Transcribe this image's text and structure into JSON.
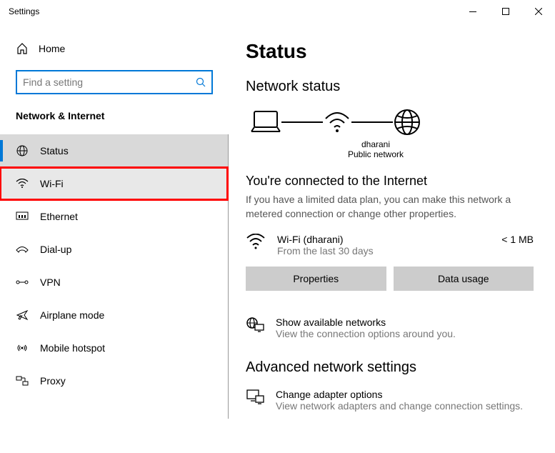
{
  "titlebar": {
    "title": "Settings"
  },
  "sidebar": {
    "home": "Home",
    "search_placeholder": "Find a setting",
    "category": "Network & Internet",
    "items": [
      {
        "label": "Status"
      },
      {
        "label": "Wi-Fi"
      },
      {
        "label": "Ethernet"
      },
      {
        "label": "Dial-up"
      },
      {
        "label": "VPN"
      },
      {
        "label": "Airplane mode"
      },
      {
        "label": "Mobile hotspot"
      },
      {
        "label": "Proxy"
      }
    ]
  },
  "main": {
    "title": "Status",
    "network_status_heading": "Network status",
    "diagram": {
      "ssid": "dharani",
      "type": "Public network"
    },
    "connected": {
      "title": "You're connected to the Internet",
      "desc": "If you have a limited data plan, you can make this network a metered connection or change other properties."
    },
    "wifi": {
      "name": "Wi-Fi (dharani)",
      "sub": "From the last 30 days",
      "data": "< 1 MB"
    },
    "buttons": {
      "properties": "Properties",
      "data_usage": "Data usage"
    },
    "show_networks": {
      "title": "Show available networks",
      "desc": "View the connection options around you."
    },
    "advanced_heading": "Advanced network settings",
    "adapter": {
      "title": "Change adapter options",
      "desc": "View network adapters and change connection settings."
    }
  }
}
